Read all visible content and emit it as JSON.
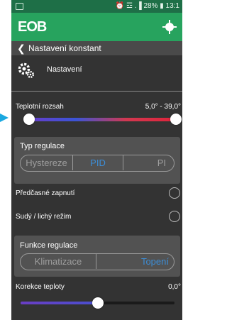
{
  "status_bar": {
    "right_text": "⏰ ☲ .▐ 28% ▮ 13:1"
  },
  "app_bar": {
    "logo_text": "EOB"
  },
  "title_bar": {
    "title": "Nastavení konstant"
  },
  "settings": {
    "label": "Nastavení"
  },
  "temp_range": {
    "label": "Teplotní rozsah",
    "value": "5,0° -  39,0°",
    "min_level": 0.03,
    "max_level": 1.0
  },
  "regulation_type": {
    "title": "Typ regulace",
    "options": [
      "Hystereze",
      "PID",
      "PI"
    ],
    "selected": "PID"
  },
  "early_start": {
    "label": "Předčasné zapnutí"
  },
  "even_odd_mode": {
    "label": "Sudý / lichý režim"
  },
  "regulation_function": {
    "title": "Funkce regulace",
    "options": [
      "Klimatizace",
      "Topení"
    ],
    "selected": "Topení"
  },
  "temp_correction": {
    "label": "Korekce teploty",
    "value": "0,0°",
    "level": 0.5
  },
  "colors": {
    "appbar": "#27a35e",
    "statusbar": "#1e6f47",
    "accent": "#3c8dd6",
    "background": "#333333"
  }
}
